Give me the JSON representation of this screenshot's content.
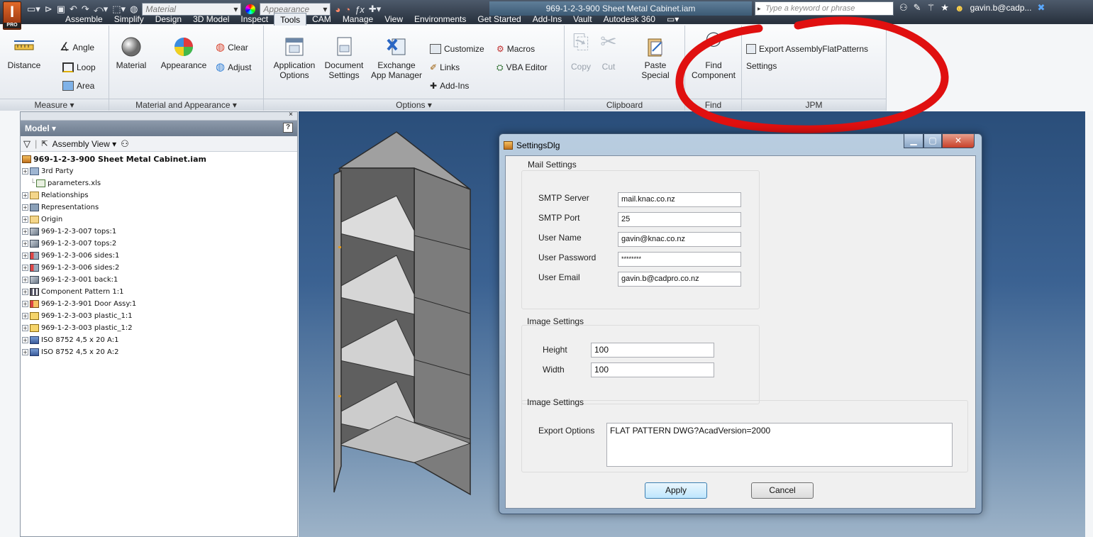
{
  "titlebar": {
    "app_badge": "PRO",
    "material_combo": "Material",
    "appearance_combo": "Appearance",
    "document_title": "969-1-2-3-900 Sheet Metal Cabinet.iam",
    "search_placeholder": "Type a keyword or phrase",
    "user": "gavin.b@cadp..."
  },
  "tabs": [
    "Assemble",
    "Simplify",
    "Design",
    "3D Model",
    "Inspect",
    "Tools",
    "CAM",
    "Manage",
    "View",
    "Environments",
    "Get Started",
    "Add-Ins",
    "Vault",
    "Autodesk 360"
  ],
  "active_tab": "Tools",
  "ribbon": {
    "measure": {
      "label": "Measure ▾",
      "distance": "Distance",
      "angle": "Angle",
      "loop": "Loop",
      "area": "Area"
    },
    "material_appearance": {
      "label": "Material and Appearance ▾",
      "material": "Material",
      "appearance": "Appearance",
      "clear": "Clear",
      "adjust": "Adjust"
    },
    "options": {
      "label": "Options ▾",
      "app_options_1": "Application",
      "app_options_2": "Options",
      "doc_settings_1": "Document",
      "doc_settings_2": "Settings",
      "exchange_1": "Exchange",
      "exchange_2": "App Manager",
      "customize": "Customize",
      "links": "Links",
      "addins": "Add-Ins",
      "macros": "Macros",
      "vba": "VBA Editor"
    },
    "clipboard": {
      "label": "Clipboard",
      "copy": "Copy",
      "cut": "Cut",
      "paste_1": "Paste",
      "paste_2": "Special"
    },
    "find": {
      "label": "Find",
      "find_1": "Find",
      "find_2": "Component"
    },
    "jpm": {
      "label": "JPM",
      "export": "Export AssemblyFlatPatterns",
      "settings": "Settings"
    }
  },
  "model_browser": {
    "title": "Model ▾",
    "view": "Assembly View",
    "tree": [
      {
        "label": "969-1-2-3-900 Sheet Metal Cabinet.iam",
        "level": 0,
        "icon": "assembly-icon",
        "root": true
      },
      {
        "label": "3rd Party",
        "level": 1,
        "icon": "folder-3rd-party-icon"
      },
      {
        "label": "parameters.xls",
        "level": 2,
        "icon": "spreadsheet-icon"
      },
      {
        "label": "Relationships",
        "level": 1,
        "icon": "folder-icon"
      },
      {
        "label": "Representations",
        "level": 1,
        "icon": "representations-icon"
      },
      {
        "label": "Origin",
        "level": 1,
        "icon": "folder-icon"
      },
      {
        "label": "969-1-2-3-007 tops:1",
        "level": 1,
        "icon": "sheet-metal-part-icon"
      },
      {
        "label": "969-1-2-3-007 tops:2",
        "level": 1,
        "icon": "sheet-metal-part-icon"
      },
      {
        "label": "969-1-2-3-006 sides:1",
        "level": 1,
        "icon": "constrained-part-icon"
      },
      {
        "label": "969-1-2-3-006 sides:2",
        "level": 1,
        "icon": "constrained-part-icon"
      },
      {
        "label": "969-1-2-3-001 back:1",
        "level": 1,
        "icon": "sheet-metal-part-icon"
      },
      {
        "label": "Component Pattern 1:1",
        "level": 1,
        "icon": "pattern-icon"
      },
      {
        "label": "969-1-2-3-901 Door Assy:1",
        "level": 1,
        "icon": "subassembly-icon"
      },
      {
        "label": "969-1-2-3-003 plastic_1:1",
        "level": 1,
        "icon": "part-icon"
      },
      {
        "label": "969-1-2-3-003 plastic_1:2",
        "level": 1,
        "icon": "part-icon"
      },
      {
        "label": "ISO 8752 4,5 x 20  A:1",
        "level": 1,
        "icon": "fastener-icon"
      },
      {
        "label": "ISO 8752 4,5 x 20  A:2",
        "level": 1,
        "icon": "fastener-icon"
      }
    ]
  },
  "dialog": {
    "title": "SettingsDlg",
    "mail_group": "Mail Settings",
    "smtp_server_label": "SMTP Server",
    "smtp_server_value": "mail.knac.co.nz",
    "smtp_port_label": "SMTP Port",
    "smtp_port_value": "25",
    "user_name_label": "User Name",
    "user_name_value": "gavin@knac.co.nz",
    "user_password_label": "User Password",
    "user_password_value": "********",
    "user_email_label": "User Email",
    "user_email_value": "gavin.b@cadpro.co.nz",
    "image_group": "Image Settings",
    "height_label": "Height",
    "height_value": "100",
    "width_label": "Width",
    "width_value": "100",
    "export_group": "Image Settings",
    "export_label": "Export Options",
    "export_value": "FLAT PATTERN DWG?AcadVersion=2000",
    "apply": "Apply",
    "cancel": "Cancel"
  },
  "colors": {
    "annotation_circle": "#e01010",
    "viewport_top": "#2a4e7a",
    "ribbon_bg": "#f4f6f8"
  }
}
